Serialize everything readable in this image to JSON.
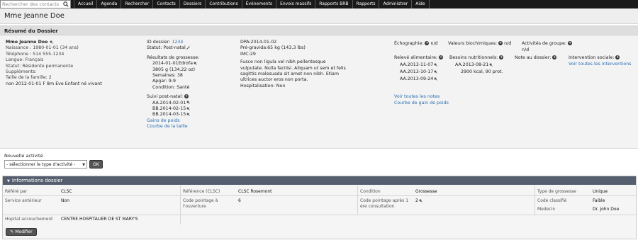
{
  "topbar": {
    "search_placeholder": "Rechercher des contacts",
    "nav": [
      "Accueil",
      "Agenda",
      "Rechercher",
      "Contacts",
      "Dossiers",
      "Contributions",
      "Événements",
      "Envois massifs",
      "Rapports BRB",
      "Rapports",
      "Administrer",
      "Aide"
    ]
  },
  "page_title": "Mme Jeanne Doe",
  "section_title": "Résumé du Dossier",
  "contact": {
    "name": "Mme Jeanne Doe",
    "naissance": "Naissance : 1980-01-01 (34 ans)",
    "telephone": "Téléphone : 514 555-1234",
    "langue": "Langue: Français",
    "statut": "Statut: Résidente permanente",
    "supplements": "Suppléments:",
    "taille_famille": "Taille de la famille: 2",
    "enfant": "non 2012-01-01 F 8m Eve Enfant né vivant"
  },
  "dossier": {
    "id_label": "ID dossier:",
    "id_value": "1234",
    "statut": "Statut: Post-natal",
    "resultats_label": "Résultats de grossesse:",
    "resultats": [
      "2014-01-01Edrofa",
      "3805 g (134.22 oz)",
      "Semaines: 38",
      "Apgar: 9-9",
      "Condition: Santé"
    ],
    "suivi_label": "Suivi post-natal:",
    "suivi": [
      "AA.2014-02-01",
      "BB.2014-02-15",
      "BB.2014-03-15"
    ],
    "link_gains": "Gains de poids",
    "link_taille": "Courbe de la taille"
  },
  "grossesse": {
    "dpa": "DPA:2014-01-02",
    "pre_gravida": "Pré-gravida:65 kg (143.3 lbs)",
    "imc": "IMC:29",
    "notes": [
      "Fusce non ligula vel nibh pellentesque",
      "vulputate. Nulla facilisi. Aliquam ut sem et felis",
      "sagittis malesuada sit amet non nibh. Etiam",
      "ultrices auctor eros non porta."
    ],
    "hospitalisation": "Hospitalisation: Non"
  },
  "suivi": {
    "echographie": "Échographie:",
    "echographie_val": "n/d",
    "valeurs_bio": "Valeurs biochimiques:",
    "valeurs_bio_val": "n/d",
    "activites": "Activités de groupe:",
    "activites_val": "n/d",
    "releve": "Relevé alimentaire:",
    "releve_items": [
      "AA.2013-11-07",
      "AA.2013-10-17",
      "AA.2013-09-24"
    ],
    "besoins": "Besoins nutritionnels:",
    "besoins_items": [
      "AA.2013-08-21",
      "2900 kcal, 90 prot."
    ],
    "note_dossier": "Note au dossier:",
    "intervention": "Intervention sociale:",
    "voir_interventions": "Voir toutes les interventions",
    "voir_notes": "Voir toutes les notes",
    "courbe_poids": "Courbe de gain de poids"
  },
  "activity": {
    "label": "Nouvelle activité",
    "select_value": "- sélectionner le type d'activité -",
    "ok": "OK"
  },
  "info": {
    "header": "Informations dossier",
    "refere_par_label": "Référé par",
    "refere_par_val": "CLSC",
    "service_anterieur_label": "Service antérieur",
    "service_anterieur_val": "Non",
    "hopital_label": "Hopital accouchement",
    "hopital_val": "CENTRE HOSPITALIER DE ST MARY'S",
    "reference_label": "Référence (CLSC)",
    "reference_val": "CLSC Rosemont",
    "code_ouverture_label": "Code pointage à l'ouverture",
    "code_ouverture_val": "6",
    "condition_label": "Condition",
    "condition_val": "Grossesse",
    "code_apres_label": "Code pointage après 1 ère consultation",
    "code_apres_val": "2",
    "type_label": "Type de grossesse",
    "type_val": "Unique",
    "code_classifie_label": "Code classifié",
    "code_classifie_val": "Faible",
    "medecin_label": "Medecin",
    "medecin_val": "Dr. John Doe",
    "modifier": "Modifier"
  }
}
